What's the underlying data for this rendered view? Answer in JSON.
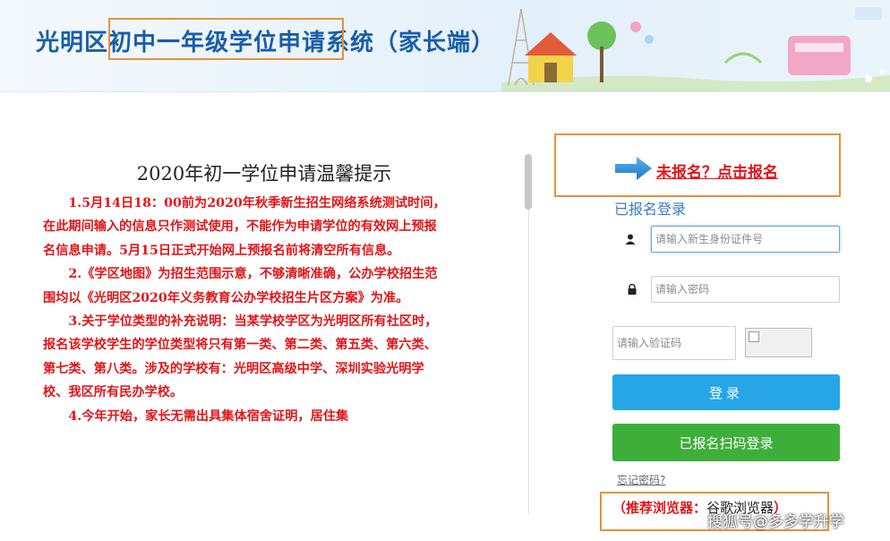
{
  "header": {
    "title": "光明区初中一年级学位申请系统（家长端）"
  },
  "notice": {
    "title": "2020年初一学位申请温馨提示",
    "paragraphs": [
      "1.5月14日18：00前为2020年秋季新生招生网络系统测试时间，在此期间输入的信息只作测试使用，不能作为申请学位的有效网上预报名信息申请。5月15日正式开始网上预报名前将清空所有信息。",
      "2.《学区地图》为招生范围示意，不够清晰准确，公办学校招生范围均以《光明区2020年义务教育公办学校招生片区方案》为准。",
      "3.关于学位类型的补充说明：当某学校学区为光明区所有社区时，报名该学校学生的学位类型将只有第一类、第二类、第五类、第六类、第七类、第八类。涉及的学校有：光明区高级中学、深圳实验光明学校、我区所有民办学校。",
      "4.今年开始，家长无需出具集体宿舍证明，居住集"
    ]
  },
  "login": {
    "register_link": "未报名？点击报名",
    "title": "已报名登录",
    "id_placeholder": "请输入新生身份证件号",
    "password_placeholder": "请输入密码",
    "captcha_placeholder": "请输入验证码",
    "login_button": "登录",
    "qr_login_button": "已报名扫码登录",
    "forgot_password": "忘记密码?",
    "recommend_label": "（推荐浏览器：",
    "recommend_value": "谷歌浏览器",
    "recommend_end": "）"
  },
  "watermark": "搜狐号@多多学升学",
  "icons": {
    "user": "user-icon",
    "lock": "lock-icon",
    "arrow": "arrow-right-icon"
  },
  "colors": {
    "brand_blue": "#1a5ea8",
    "notice_red": "#e0161a",
    "login_blue": "#26a6e6",
    "qr_green": "#3eae3b",
    "highlight_orange": "#e8913a"
  }
}
